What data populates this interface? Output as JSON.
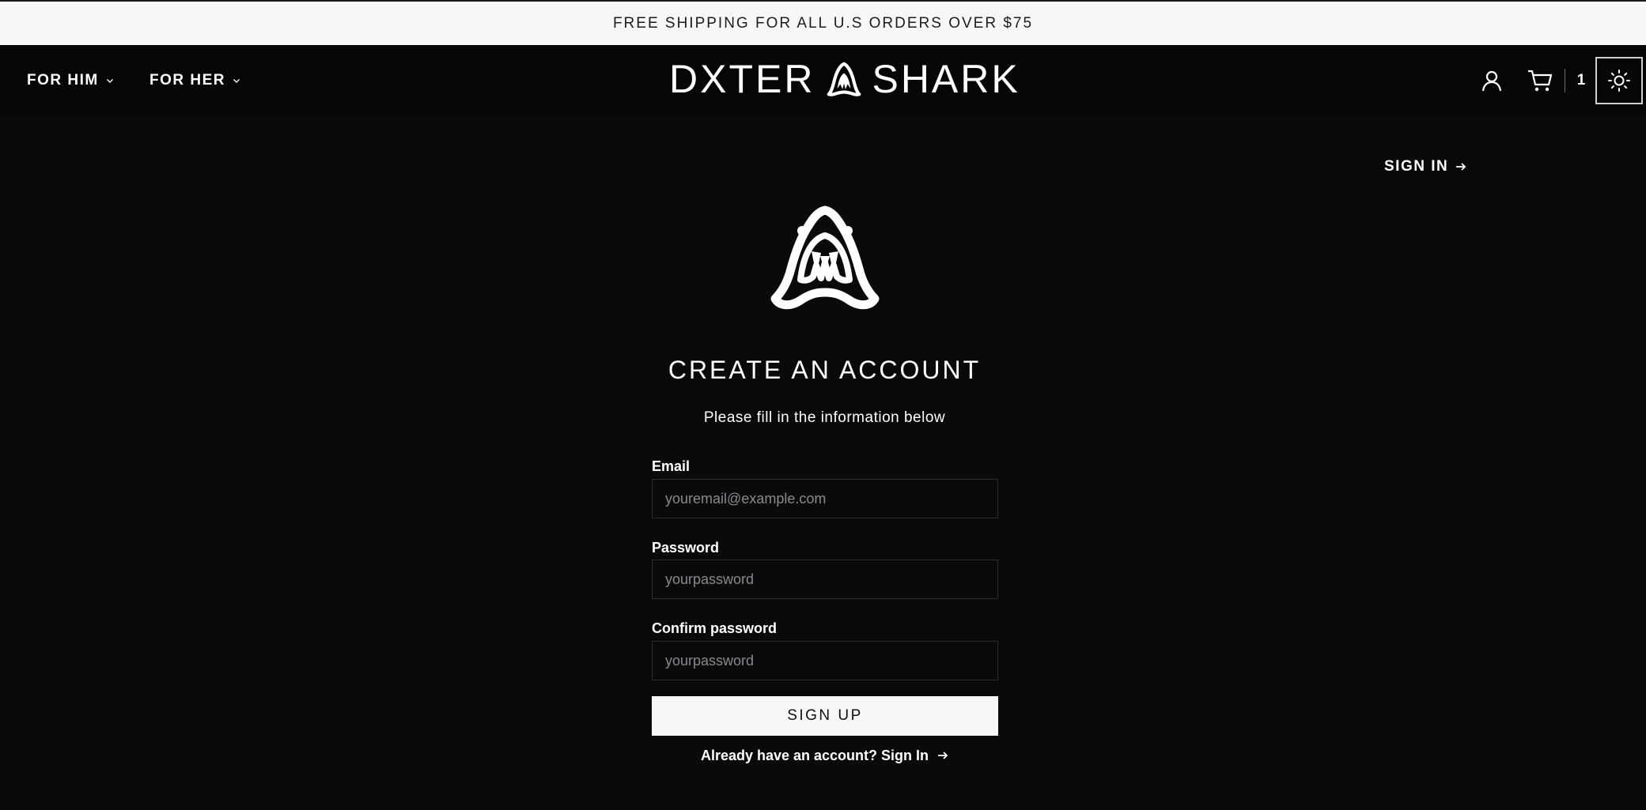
{
  "announcement": "FREE SHIPPING FOR ALL U.S ORDERS OVER $75",
  "nav": {
    "items": [
      {
        "label": "FOR HIM"
      },
      {
        "label": "FOR HER"
      }
    ]
  },
  "brand": {
    "left": "DXTER",
    "right": "SHARK"
  },
  "header": {
    "cart_count": "1"
  },
  "signin_link": "SIGN IN",
  "form": {
    "title": "CREATE AN ACCOUNT",
    "subtitle": "Please fill in the information below",
    "email": {
      "label": "Email",
      "placeholder": "youremail@example.com",
      "value": ""
    },
    "password": {
      "label": "Password",
      "placeholder": "yourpassword",
      "value": ""
    },
    "confirm": {
      "label": "Confirm password",
      "placeholder": "yourpassword",
      "value": ""
    },
    "submit_label": "SIGN UP",
    "already_text": "Already have an account? Sign In"
  },
  "colors": {
    "background": "#0a0a0c",
    "header": "#060608",
    "announcement_bg": "#f7f7f8",
    "button_bg": "#f7f7f8",
    "text": "#ffffff"
  },
  "icons": [
    "chevron-down-icon",
    "shark-logo-icon",
    "account-icon",
    "cart-icon",
    "sun-icon",
    "arrow-right-icon"
  ]
}
